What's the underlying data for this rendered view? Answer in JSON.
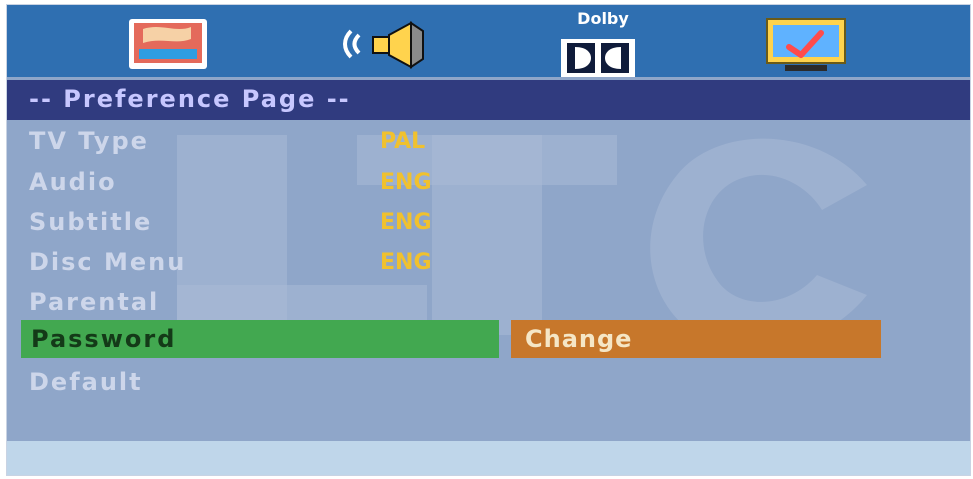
{
  "topbar": {
    "tabs": [
      {
        "icon": "picture-icon"
      },
      {
        "icon": "speaker-icon"
      },
      {
        "icon": "dolby-icon",
        "label": "Dolby"
      },
      {
        "icon": "preferences-monitor-icon"
      }
    ]
  },
  "header": {
    "title": "-- Preference Page --"
  },
  "menu": {
    "items": [
      {
        "label": "TV Type",
        "value": "PAL"
      },
      {
        "label": "Audio",
        "value": "ENG"
      },
      {
        "label": "Subtitle",
        "value": "ENG"
      },
      {
        "label": "Disc Menu",
        "value": "ENG"
      },
      {
        "label": "Parental",
        "value": ""
      },
      {
        "label": "Password",
        "value": "Change"
      },
      {
        "label": "Default",
        "value": ""
      }
    ],
    "selected_index": 5
  },
  "watermark": {
    "text": "LTC"
  },
  "colors": {
    "topbar": "#2f6fb1",
    "header": "#303b7f",
    "background": "#8fa6c9",
    "selected_row": "#42a850",
    "selected_value": "#c7772b",
    "value_text": "#f0c12e"
  }
}
